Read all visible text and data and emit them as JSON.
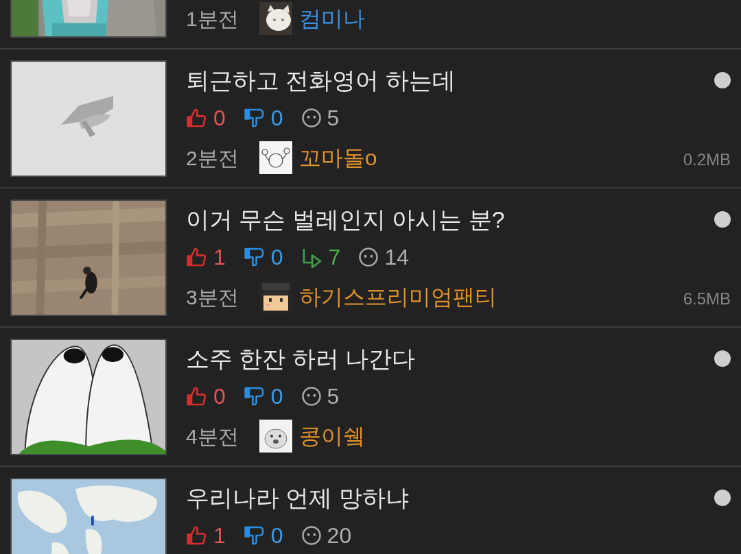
{
  "posts": [
    {
      "thumbnail": {
        "kind": "picture"
      },
      "time": "1분전",
      "author": {
        "name": "컴미나",
        "color": "#3b8fe0"
      }
    },
    {
      "thumbnail": {
        "kind": "placeholder"
      },
      "title": "퇴근하고 전화영어 하는데",
      "unread": true,
      "stats": [
        {
          "kind": "up",
          "value": "0"
        },
        {
          "kind": "down",
          "value": "0"
        },
        {
          "kind": "comments",
          "value": "5"
        }
      ],
      "time": "2분전",
      "author": {
        "name": "꼬마돌o",
        "color": "#e0922a"
      },
      "size": "0.2MB"
    },
    {
      "thumbnail": {
        "kind": "picture"
      },
      "title": "이거 무슨 벌레인지 아시는 분?",
      "unread": true,
      "stats": [
        {
          "kind": "up",
          "value": "1"
        },
        {
          "kind": "down",
          "value": "0"
        },
        {
          "kind": "replies",
          "value": "7"
        },
        {
          "kind": "comments",
          "value": "14"
        }
      ],
      "time": "3분전",
      "author": {
        "name": "하기스프리미엄팬티",
        "color": "#e0922a"
      },
      "size": "6.5MB"
    },
    {
      "thumbnail": {
        "kind": "picture"
      },
      "title": "소주 한잔 하러 나간다",
      "unread": true,
      "stats": [
        {
          "kind": "up",
          "value": "0"
        },
        {
          "kind": "down",
          "value": "0"
        },
        {
          "kind": "comments",
          "value": "5"
        }
      ],
      "time": "4분전",
      "author": {
        "name": "콩이쉨",
        "color": "#e0922a"
      }
    },
    {
      "thumbnail": {
        "kind": "picture"
      },
      "title": "우리나라 언제 망하냐",
      "unread": true,
      "stats": [
        {
          "kind": "up",
          "value": "1"
        },
        {
          "kind": "down",
          "value": "0"
        },
        {
          "kind": "comments",
          "value": "20"
        }
      ]
    }
  ]
}
